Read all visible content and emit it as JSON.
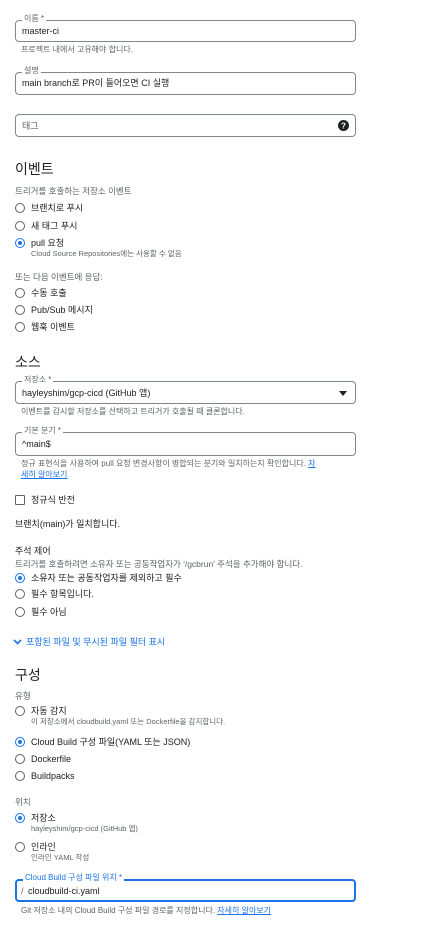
{
  "name_field": {
    "label": "이름 *",
    "value": "master-ci",
    "hint": "프로젝트 내에서 고유해야 합니다."
  },
  "description_field": {
    "label": "설명",
    "value": "main branch로 PR이 들어오면 CI 실행"
  },
  "tags_field": {
    "label": "태그"
  },
  "event_section": {
    "title": "이벤트",
    "repo_event_label": "트리거를 호출하는 저장소 이벤트",
    "repo_events": [
      {
        "label": "브랜치로 푸시",
        "desc": ""
      },
      {
        "label": "새 태그 푸시",
        "desc": ""
      },
      {
        "label": "pull 요청",
        "desc": "Cloud Source Repositories에는 사용할 수 없음"
      }
    ],
    "other_event_label": "또는 다음 이벤트에 응답:",
    "other_events": [
      {
        "label": "수동 호출"
      },
      {
        "label": "Pub/Sub 메시지"
      },
      {
        "label": "웹훅 이벤트"
      }
    ]
  },
  "source_section": {
    "title": "소스",
    "repo_field": {
      "label": "저장소 *",
      "value": "hayleyshim/gcp-cicd (GitHub 앱)"
    },
    "repo_hint": "이벤트를 감시할 저장소를 선택하고 트리거가 호출될 때 클론합니다.",
    "branch_field": {
      "label": "기본 분기 *",
      "value": "^main$"
    },
    "branch_hint": "정규 표현식을 사용하여 pull 요청 변경사항이 병합되는 분기와 일치하는지 확인합니다.",
    "branch_hint_link_1": "자",
    "branch_hint_link_2": "세히 알아보기",
    "invert_regex_label": "정규식 반전",
    "match_text": "브랜치(main)가 일치합니다.",
    "comment_control_title": "주석 제어",
    "comment_control_hint": "트리거를 호출하려면 소유자 또는 공동작업자가 '/gcbrun' 주석을 추가해야 합니다.",
    "comment_options": [
      {
        "label": "소유자 또는 공동작업자를 제외하고 필수"
      },
      {
        "label": "필수 항목입니다."
      },
      {
        "label": "필수 아님"
      }
    ],
    "filter_toggle_label": "포함된 파일 및 무시된 파일 필터 표시"
  },
  "config_section": {
    "title": "구성",
    "type_label": "유형",
    "types": [
      {
        "label": "자동 감지",
        "desc": "이 저장소에서 cloudbuild.yaml 또는 Dockerfile을 감지합니다."
      },
      {
        "label": "Cloud Build 구성 파일(YAML 또는 JSON)",
        "desc": ""
      },
      {
        "label": "Dockerfile",
        "desc": ""
      },
      {
        "label": "Buildpacks",
        "desc": ""
      }
    ],
    "location_label": "위치",
    "locations": [
      {
        "label": "저장소",
        "desc": "hayleyshim/gcp-cicd (GitHub 앱)"
      },
      {
        "label": "인라인",
        "desc": "인라인 YAML 작성"
      }
    ],
    "file_field": {
      "label": "Cloud Build 구성 파일 위치 *",
      "prefix": "/",
      "value": "cloudbuild-ci.yaml"
    },
    "file_hint": "Git 저장소 내의 Cloud Build 구성 파일 경로를 지정합니다.",
    "file_hint_link": "자세히 알아보기"
  },
  "colors": {
    "accent": "#1a73e8",
    "text": "#202124",
    "muted": "#5f6368",
    "border": "#80868b"
  },
  "icons": {
    "help": "help-circle-icon",
    "dropdown": "arrow-drop-down-icon",
    "expand": "chevron-down-icon"
  }
}
